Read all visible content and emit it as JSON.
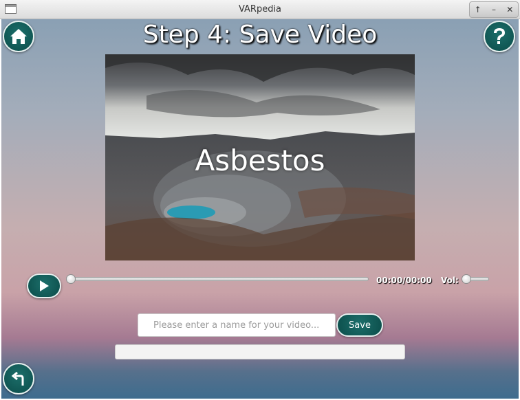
{
  "window": {
    "title": "VARpedia",
    "controls": [
      "↑",
      "–",
      "✕"
    ]
  },
  "header": {
    "step_title": "Step 4: Save Video",
    "home_icon": "home-icon",
    "help_icon": "question-mark-icon"
  },
  "preview": {
    "caption": "Asbestos",
    "image_description_icon": "open-pit-mine-landscape"
  },
  "player": {
    "time": "00:00/00:00",
    "volume_label": "Vol:",
    "seek_position": 0,
    "volume_level": 0
  },
  "save": {
    "placeholder": "Please enter a name for your video...",
    "value": "",
    "button_label": "Save"
  },
  "progress": {
    "value": 0
  },
  "colors": {
    "accent": "#0b4d4a",
    "button_border": "#e6f0ef"
  }
}
